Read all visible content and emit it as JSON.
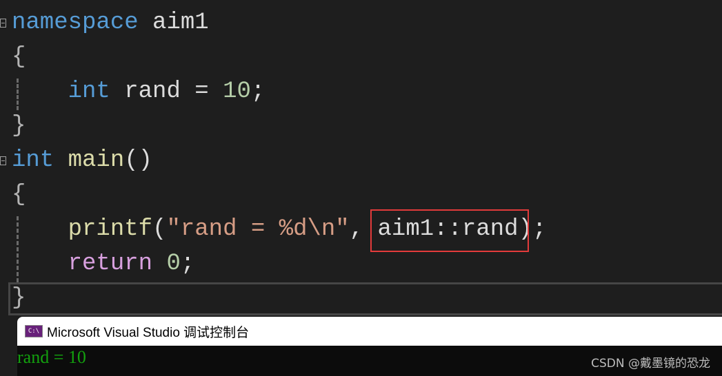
{
  "colors": {
    "background": "#1e1e1e",
    "keyword": "#569cd6",
    "identifier": "#dcdcdc",
    "number": "#b5cea8",
    "string": "#d69d85",
    "function": "#dcdcaa",
    "control": "#d8a0df",
    "punct": "#b4b4b4",
    "highlight_box": "#e33b3b",
    "console_output": "#13a10e"
  },
  "code": [
    {
      "indent": 0,
      "tokens": [
        {
          "t": "namespace",
          "k": "keyword"
        },
        {
          "t": " aim1",
          "k": "identifier"
        }
      ]
    },
    {
      "indent": 0,
      "tokens": [
        {
          "t": "{",
          "k": "punct"
        }
      ]
    },
    {
      "indent": 4,
      "tokens": [
        {
          "t": "int",
          "k": "keyword"
        },
        {
          "t": " rand = ",
          "k": "identifier"
        },
        {
          "t": "10",
          "k": "number"
        },
        {
          "t": ";",
          "k": "identifier"
        }
      ]
    },
    {
      "indent": 0,
      "tokens": [
        {
          "t": "}",
          "k": "punct"
        }
      ]
    },
    {
      "indent": 0,
      "tokens": [
        {
          "t": "int",
          "k": "keyword"
        },
        {
          "t": " ",
          "k": "identifier"
        },
        {
          "t": "main",
          "k": "function"
        },
        {
          "t": "()",
          "k": "identifier"
        }
      ]
    },
    {
      "indent": 0,
      "tokens": [
        {
          "t": "{",
          "k": "punct"
        }
      ]
    },
    {
      "indent": 4,
      "tokens": [
        {
          "t": "printf",
          "k": "function"
        },
        {
          "t": "(",
          "k": "identifier"
        },
        {
          "t": "\"rand = %d\\n\"",
          "k": "string"
        },
        {
          "t": ", aim1::rand);",
          "k": "identifier"
        }
      ]
    },
    {
      "indent": 4,
      "tokens": [
        {
          "t": "return",
          "k": "control"
        },
        {
          "t": " ",
          "k": "identifier"
        },
        {
          "t": "0",
          "k": "number"
        },
        {
          "t": ";",
          "k": "identifier"
        }
      ]
    },
    {
      "indent": 0,
      "tokens": [
        {
          "t": "}",
          "k": "punct"
        }
      ]
    }
  ],
  "console": {
    "icon": "console-app-icon",
    "icon_text": "C:\\",
    "title": "Microsoft Visual Studio 调试控制台",
    "output": "rand = 10"
  },
  "watermark": "CSDN @戴墨镜的恐龙"
}
